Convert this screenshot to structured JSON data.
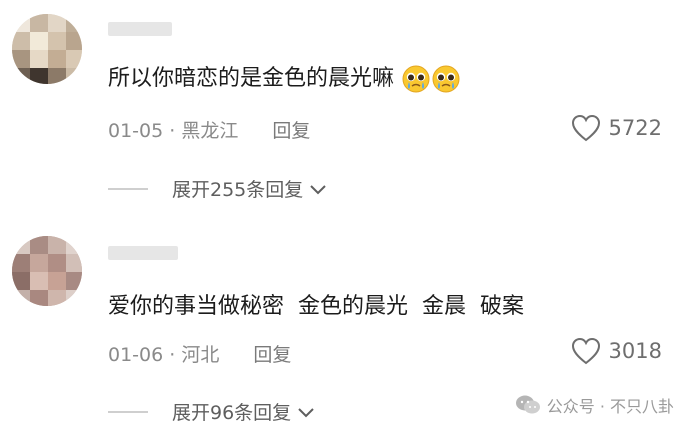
{
  "comments": [
    {
      "text": "所以你暗恋的是金色的晨光嘛",
      "emojis": [
        "pleading-face-icon",
        "pleading-face-icon"
      ],
      "date": "01-05",
      "location": "黑龙江",
      "reply_label": "回复",
      "likes": "5722",
      "expand_label": "展开255条回复"
    },
    {
      "text": "爱你的事当做秘密  金色的晨光  金晨  破案",
      "emojis": [],
      "date": "01-06",
      "location": "河北",
      "reply_label": "回复",
      "likes": "3018",
      "expand_label": "展开96条回复"
    }
  ],
  "watermark": {
    "text": "公众号 · 不只八卦",
    "icon": "wechat-icon"
  },
  "colors": {
    "text": "#1c1c1c",
    "meta": "#8a8a8a",
    "bg": "#ffffff"
  }
}
